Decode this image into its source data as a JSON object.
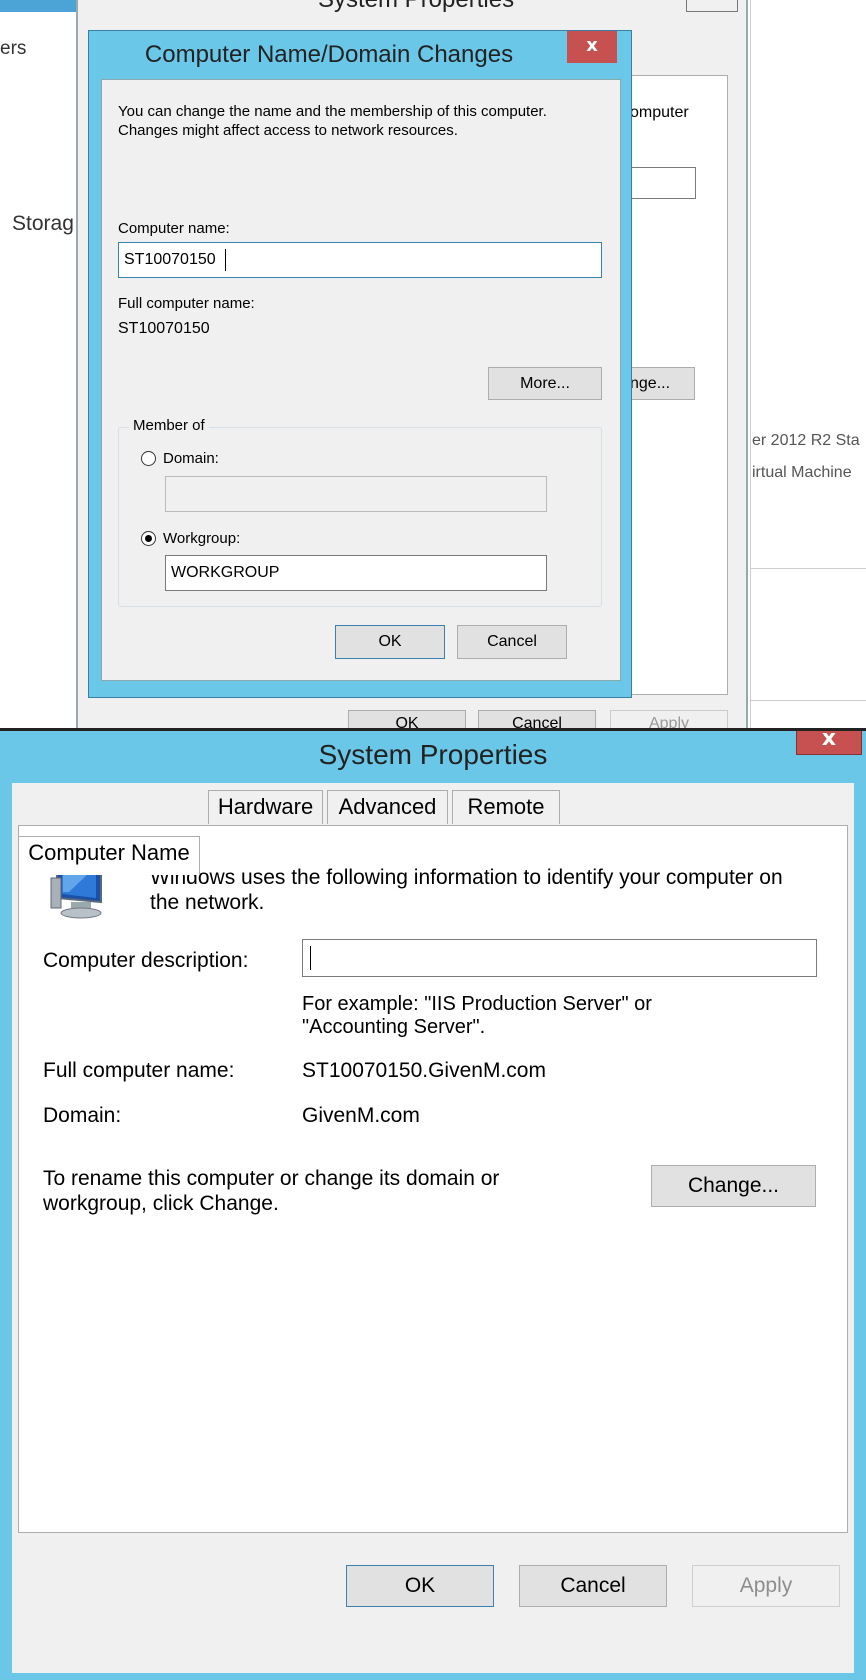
{
  "top": {
    "bg_title": "System Properties",
    "bg_frag_ers": "ers",
    "bg_frag_storage": "Storag",
    "bg_frag_computer": "omputer",
    "bg_frag_change": "nge...",
    "bg_frag_server": "er 2012 R2 Sta",
    "bg_frag_vm": "irtual Machine",
    "bg_ok": "OK",
    "bg_cancel": "Cancel",
    "bg_apply": "Apply",
    "dialog": {
      "title": "Computer Name/Domain Changes",
      "close": "x",
      "description": "You can change the name and the membership of this computer. Changes might affect access to network resources.",
      "computer_name_label": "Computer name:",
      "computer_name_value": "ST10070150",
      "full_name_label": "Full computer name:",
      "full_name_value": "ST10070150",
      "more_button": "More...",
      "member_of_label": "Member of",
      "domain_label": "Domain:",
      "domain_value": "",
      "workgroup_label": "Workgroup:",
      "workgroup_value": "WORKGROUP",
      "ok_button": "OK",
      "cancel_button": "Cancel"
    }
  },
  "bottom": {
    "title": "System Properties",
    "close": "x",
    "tabs": [
      "Computer Name",
      "Hardware",
      "Advanced",
      "Remote"
    ],
    "intro": "Windows uses the following information to identify your computer on the network.",
    "description_label": "Computer description:",
    "description_value": "",
    "example_text": "For example: \"IIS Production Server\" or \"Accounting Server\".",
    "full_name_label": "Full computer name:",
    "full_name_value": "ST10070150.GivenM.com",
    "domain_label": "Domain:",
    "domain_value": "GivenM.com",
    "rename_text": "To rename this computer or change its domain or workgroup, click Change.",
    "change_button": "Change...",
    "ok_button": "OK",
    "cancel_button": "Cancel",
    "apply_button": "Apply"
  },
  "colors": {
    "frame_blue": "#6bc7e8",
    "close_red": "#c75050",
    "dialog_bg": "#f0f0f0"
  },
  "icons": [
    "computer-monitor-icon",
    "close-icon"
  ]
}
